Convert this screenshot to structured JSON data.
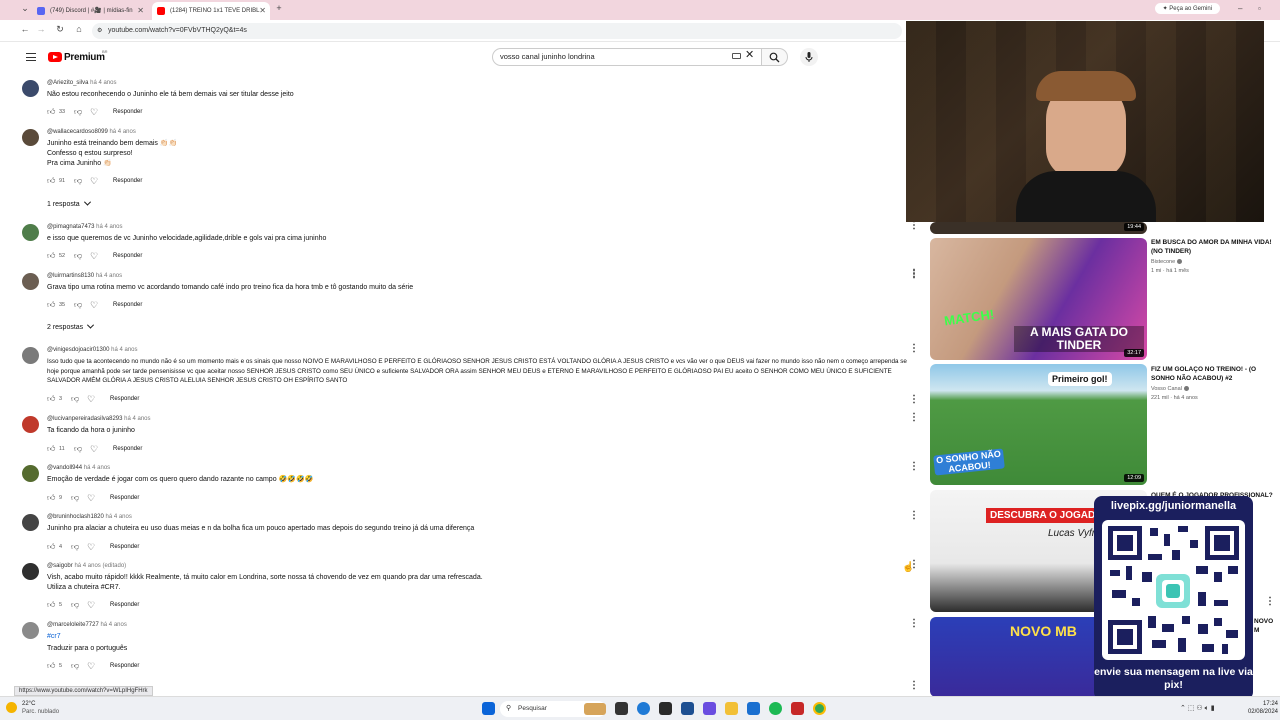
{
  "browser": {
    "tabs": [
      {
        "title": "(749) Discord | #🎥 | mídias-fin",
        "fav_color": "#5865f2",
        "active": false
      },
      {
        "title": "(1284) TREINO 1x1 TEVE DRIBL",
        "fav_color": "#ff0000",
        "active": true
      }
    ],
    "url": "youtube.com/watch?v=0FVbVTHQ2yQ&t=4s",
    "gemini_label": "Peça ao Gemini"
  },
  "youtube": {
    "logo_text": "Premium",
    "country": "BR",
    "search_value": "vosso canal juninho londrina"
  },
  "comments": [
    {
      "user": "@Ariezito_silva",
      "time": "há 4 anos",
      "text": [
        "Não estou reconhecendo o Juninho ele tá bem demais vai ser titular desse jeito"
      ],
      "likes": "33",
      "avatar": "#3b4a6b"
    },
    {
      "user": "@wallacecardoso8099",
      "time": "há 4 anos",
      "text": [
        "Juninho está treinando bem demais 👏🏻👏🏻",
        "Confesso q estou surpreso!",
        "Pra cima Juninho 👏🏻"
      ],
      "likes": "91",
      "avatar": "#5a4a3a",
      "replies": "1 resposta"
    },
    {
      "user": "@pimagnata7473",
      "time": "há 4 anos",
      "text": [
        "e isso que queremos de vc Juninho velocidade,agilidade,drible e gols vai pra cima juninho"
      ],
      "likes": "52",
      "avatar": "#4f7d4a"
    },
    {
      "user": "@luirmartins8130",
      "time": "há 4 anos",
      "text": [
        "Grava tipo uma rotina memo vc acordando tomando café indo pro treino fica da hora tmb e tô gostando muito da série"
      ],
      "likes": "35",
      "avatar": "#6b5e52",
      "replies": "2 respostas"
    },
    {
      "user": "@vinigesdojoacir01300",
      "time": "há 4 anos",
      "text": [
        "Isso tudo que ta acontecendo no mundo não é so um momento mais e os sinais que nosso NOIVO E MARAVILHOSO E PERFEITO E GLÓRIAOSO SENHOR JESUS CRISTO ESTÁ VOLTANDO GLÓRIA A JESUS CRISTO e vcs vão ver o que DEUS vai fazer no mundo isso não nem o começo arrependa se hoje porque amanhã pode ser tarde pensenisisse vc que aceitar nosso SENHOR JESUS CRISTO como SEU ÚNICO e suficiente SALVADOR ORA assim SENHOR MEU DEUS e ETERNO E MARAVILHOSO E PERFEITO E GLÓRIAOSO PAI EU aceito O SENHOR COMO MEU ÚNICO E SUFICIENTE SALVADOR AMÉM GLÓRIA A JESUS CRISTO ALELUIA SENHOR JESUS CRISTO OH ESPÍRITO SANTO"
      ],
      "likes": "3",
      "avatar": "#7a7a7a"
    },
    {
      "user": "@lucivanpereiradasilva8293",
      "time": "há 4 anos",
      "text": [
        "Ta ficando da hora o juninho"
      ],
      "likes": "11",
      "avatar": "#c0392b"
    },
    {
      "user": "@vandoll944",
      "time": "há 4 anos",
      "text": [
        "Emoção de verdade é jogar com os quero quero dando razante no campo 🤣🤣🤣🤣"
      ],
      "likes": "9",
      "avatar": "#556b2f"
    },
    {
      "user": "@bruninhoclash1820",
      "time": "há 4 anos",
      "text": [
        "Juninho pra alaciar a chuteira eu uso duas meias e n da bolha fica um pouco apertado mas depois do segundo treino já dá uma diferença"
      ],
      "likes": "4",
      "avatar": "#444444"
    },
    {
      "user": "@saigobr",
      "time": "há 4 anos (editado)",
      "text": [
        "Vish, acabo muito rápido!! kkkk Realmente, tá muito calor em Londrina, sorte nossa tá chovendo de vez em quando pra dar uma refrescada.",
        "Utiliza a chuteira #CR7."
      ],
      "likes": "5",
      "avatar": "#2f2f2f"
    },
    {
      "user": "@marceloleite7727",
      "time": "há 4 anos",
      "text": [
        "#cr7",
        "Traduzir para o português"
      ],
      "likes": "5",
      "avatar": "#8a8a8a"
    }
  ],
  "labels": {
    "reply": "Responder"
  },
  "sidebar": [
    {
      "title": "",
      "channel": "",
      "meta": "",
      "duration": "19:44"
    },
    {
      "title": "EM BUSCA DO AMOR DA MINHA VIDA! (NO TINDER)",
      "channel": "Bistecone",
      "meta": "1 mi · há 1 mês",
      "duration": "32:17",
      "overlay": "A MAIS GATA DO TINDER",
      "badge": "MATCH!"
    },
    {
      "title": "FIZ UM GOLAÇO NO TREINO! - (O SONHO NÃO ACABOU) #2",
      "channel": "Vosso Canal",
      "meta": "221 mil · há 4 anos",
      "duration": "12:09",
      "overlay": "O SONHO NÃO ACABOU!",
      "badge": "Primeiro gol!"
    },
    {
      "title": "QUEM É O JOGADOR PROFISSIONAL?",
      "channel": "",
      "meta": "",
      "duration": "",
      "overlay": "DESCUBRA O JOGADOR",
      "badge": "Lucas Vyfrg"
    },
    {
      "title": "NOVO M",
      "channel": "",
      "meta": "",
      "duration": "",
      "overlay": "NOVO MB",
      "badge": ""
    }
  ],
  "pix": {
    "url": "livepix.gg/juniormanella",
    "message": "envie sua mensagem na live via pix!"
  },
  "statusbar_url": "https://www.youtube.com/watch?v=WLpIHgFHrk",
  "taskbar": {
    "weather_temp": "22°C",
    "weather_desc": "Parc. nublado",
    "search_label": "Pesquisar",
    "time": "17:24",
    "date": "02/08/2024"
  }
}
